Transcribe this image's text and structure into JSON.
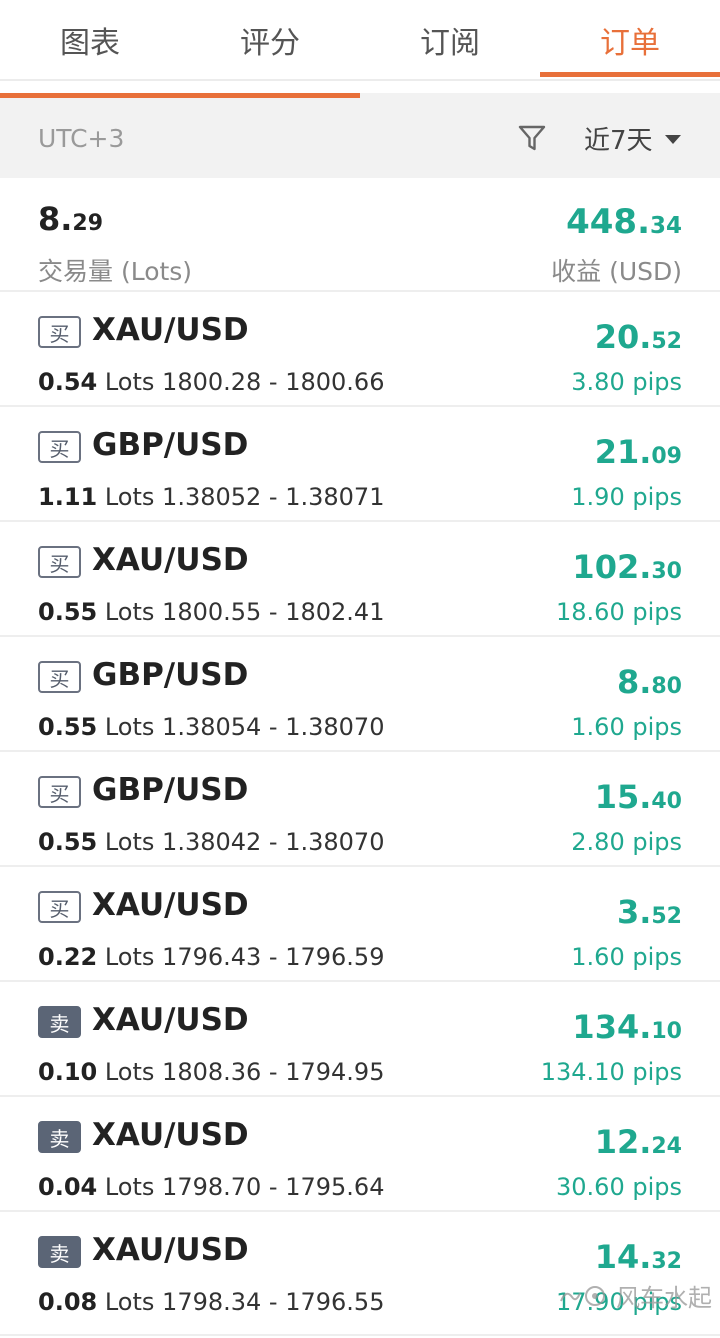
{
  "tabs": [
    {
      "label": "图表",
      "active": false
    },
    {
      "label": "评分",
      "active": false
    },
    {
      "label": "订阅",
      "active": false
    },
    {
      "label": "订单",
      "active": true
    }
  ],
  "colors": {
    "accent": "#e8703a",
    "profit": "#1fa88f",
    "sell_badge": "#5b6576"
  },
  "scroll_progress": 0.5,
  "filterbar": {
    "timezone": "UTC+3",
    "filter_icon": "filter-icon",
    "range_label": "近7天",
    "range_icon": "caret-down-icon"
  },
  "summary": {
    "volume_int": "8.",
    "volume_frac": "29",
    "volume_label": "交易量 (Lots)",
    "profit_int": "448.",
    "profit_frac": "34",
    "profit_label": "收益 (USD)"
  },
  "orders": [
    {
      "side": "买",
      "symbol": "XAU/USD",
      "lots": "0.54",
      "lots_unit": "Lots",
      "prices": "1800.28 - 1800.66",
      "profit_int": "20.",
      "profit_frac": "52",
      "pips": "3.80 pips"
    },
    {
      "side": "买",
      "symbol": "GBP/USD",
      "lots": "1.11",
      "lots_unit": "Lots",
      "prices": "1.38052 - 1.38071",
      "profit_int": "21.",
      "profit_frac": "09",
      "pips": "1.90 pips"
    },
    {
      "side": "买",
      "symbol": "XAU/USD",
      "lots": "0.55",
      "lots_unit": "Lots",
      "prices": "1800.55 - 1802.41",
      "profit_int": "102.",
      "profit_frac": "30",
      "pips": "18.60 pips"
    },
    {
      "side": "买",
      "symbol": "GBP/USD",
      "lots": "0.55",
      "lots_unit": "Lots",
      "prices": "1.38054 - 1.38070",
      "profit_int": "8.",
      "profit_frac": "80",
      "pips": "1.60 pips"
    },
    {
      "side": "买",
      "symbol": "GBP/USD",
      "lots": "0.55",
      "lots_unit": "Lots",
      "prices": "1.38042 - 1.38070",
      "profit_int": "15.",
      "profit_frac": "40",
      "pips": "2.80 pips"
    },
    {
      "side": "买",
      "symbol": "XAU/USD",
      "lots": "0.22",
      "lots_unit": "Lots",
      "prices": "1796.43 - 1796.59",
      "profit_int": "3.",
      "profit_frac": "52",
      "pips": "1.60 pips"
    },
    {
      "side": "卖",
      "symbol": "XAU/USD",
      "lots": "0.10",
      "lots_unit": "Lots",
      "prices": "1808.36 - 1794.95",
      "profit_int": "134.",
      "profit_frac": "10",
      "pips": "134.10 pips"
    },
    {
      "side": "卖",
      "symbol": "XAU/USD",
      "lots": "0.04",
      "lots_unit": "Lots",
      "prices": "1798.70 - 1795.64",
      "profit_int": "12.",
      "profit_frac": "24",
      "pips": "30.60 pips"
    },
    {
      "side": "卖",
      "symbol": "XAU/USD",
      "lots": "0.08",
      "lots_unit": "Lots",
      "prices": "1798.34 - 1796.55",
      "profit_int": "14.",
      "profit_frac": "32",
      "pips": "17.90 pips"
    }
  ],
  "watermark": "风车水起"
}
